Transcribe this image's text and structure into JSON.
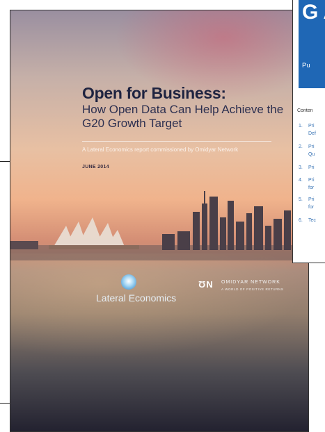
{
  "cover": {
    "title": "Open for Business:",
    "subtitle": "How Open Data Can Help Achieve the G20 Growth Target",
    "tagline": "A Lateral Economics report commissioned by Omidyar Network",
    "date": "JUNE 2014",
    "logo_left": {
      "name": "Lateral Economics",
      "icon": "lateral-economics-logo"
    },
    "logo_right": {
      "mark": "ƱN",
      "name": "OMIDYAR NETWORK",
      "tagline": "A WORLD OF POSITIVE RETURNS"
    }
  },
  "overlay_doc": {
    "title": "G A",
    "subtitle": "Pu",
    "contents_label": "Conten",
    "toc": [
      {
        "num": "1.",
        "lines": [
          "Pri",
          "Def"
        ]
      },
      {
        "num": "2.",
        "lines": [
          "Pri",
          "Qu"
        ]
      },
      {
        "num": "3.",
        "lines": [
          "Pri"
        ]
      },
      {
        "num": "4.",
        "lines": [
          "Pri",
          "for"
        ]
      },
      {
        "num": "5.",
        "lines": [
          "Pri",
          "for"
        ]
      },
      {
        "num": "6.",
        "lines": [
          "Tec"
        ]
      }
    ],
    "colors": {
      "banner": "#1f67b5",
      "link": "#3b75b5"
    }
  }
}
